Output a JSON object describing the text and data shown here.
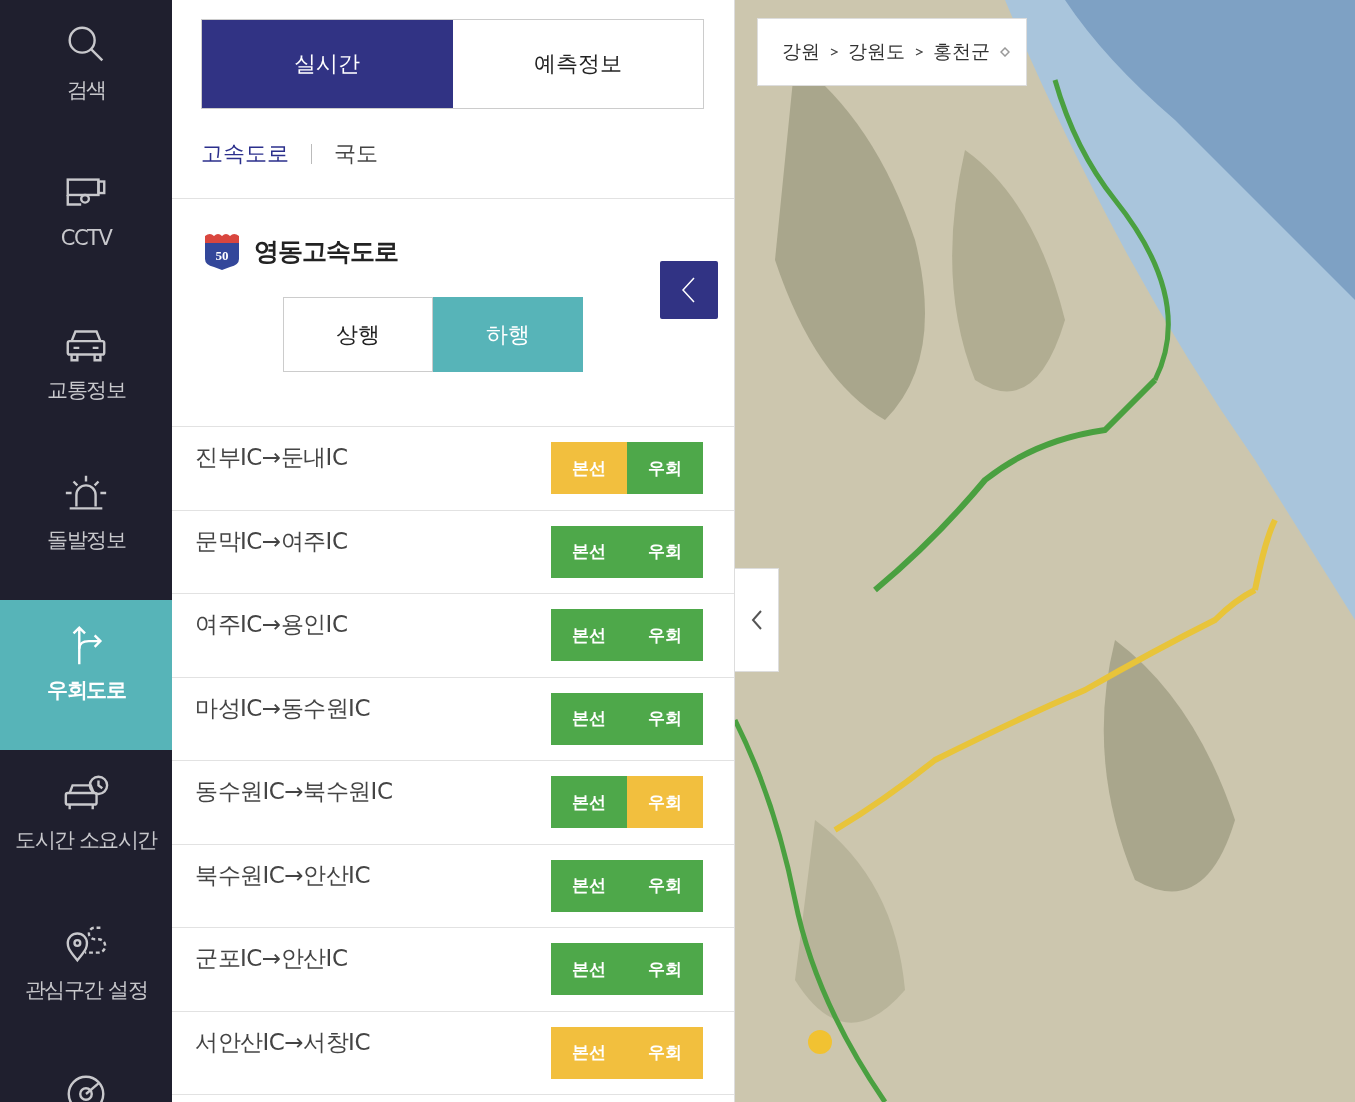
{
  "sidebar": {
    "items": [
      {
        "label": "검색",
        "selected": false
      },
      {
        "label": "CCTV",
        "selected": false
      },
      {
        "label": "교통정보",
        "selected": false
      },
      {
        "label": "돌발정보",
        "selected": false
      },
      {
        "label": "우회도로",
        "selected": true
      },
      {
        "label": "도시간 소요시간",
        "selected": false
      },
      {
        "label": "관심구간 설정",
        "selected": false
      },
      {
        "selected": false
      }
    ]
  },
  "tabs": [
    {
      "label": "실시간",
      "selected": true
    },
    {
      "label": "예측정보",
      "selected": false
    }
  ],
  "road_types": [
    {
      "label": "고속도로",
      "selected": true
    },
    {
      "label": "국도",
      "selected": false
    }
  ],
  "road": {
    "shield": "50",
    "name": "영동고속도로"
  },
  "directions": [
    {
      "label": "상행",
      "selected": false
    },
    {
      "label": "하행",
      "selected": true
    }
  ],
  "sections": [
    {
      "name": "진부IC→둔내IC",
      "segments": [
        {
          "label": "본선",
          "color": "#f2bf3e"
        },
        {
          "label": "우회",
          "color": "#4ea84a"
        }
      ]
    },
    {
      "name": "문막IC→여주IC",
      "segments": [
        {
          "label": "본선",
          "color": "#4ea84a"
        },
        {
          "label": "우회",
          "color": "#4ea84a"
        }
      ]
    },
    {
      "name": "여주IC→용인IC",
      "segments": [
        {
          "label": "본선",
          "color": "#4ea84a"
        },
        {
          "label": "우회",
          "color": "#4ea84a"
        }
      ]
    },
    {
      "name": "마성IC→동수원IC",
      "segments": [
        {
          "label": "본선",
          "color": "#4ea84a"
        },
        {
          "label": "우회",
          "color": "#4ea84a"
        }
      ]
    },
    {
      "name": "동수원IC→북수원IC",
      "segments": [
        {
          "label": "본선",
          "color": "#4ea84a"
        },
        {
          "label": "우회",
          "color": "#f2bf3e"
        }
      ]
    },
    {
      "name": "북수원IC→안산IC",
      "segments": [
        {
          "label": "본선",
          "color": "#4ea84a"
        },
        {
          "label": "우회",
          "color": "#4ea84a"
        }
      ]
    },
    {
      "name": "군포IC→안산IC",
      "segments": [
        {
          "label": "본선",
          "color": "#4ea84a"
        },
        {
          "label": "우회",
          "color": "#4ea84a"
        }
      ]
    },
    {
      "name": "서안산IC→서창IC",
      "segments": [
        {
          "label": "본선",
          "color": "#f2bf3e"
        },
        {
          "label": "우회",
          "color": "#f2bf3e"
        }
      ]
    }
  ],
  "map": {
    "breadcrumb": [
      "강원",
      "강원도",
      "홍천군"
    ]
  }
}
